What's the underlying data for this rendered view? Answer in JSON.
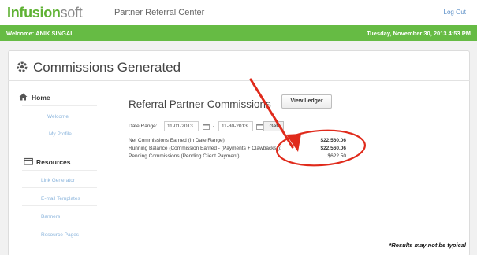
{
  "header": {
    "brand_part1": "Infusion",
    "brand_part2": "soft",
    "app_title": "Partner Referral Center",
    "logout_label": "Log Out"
  },
  "statusbar": {
    "welcome": "Welcome: ANIK SINGAL",
    "datetime": "Tuesday, November 30, 2013 4:53 PM"
  },
  "page": {
    "title": "Commissions Generated"
  },
  "sidebar": {
    "home_heading": "Home",
    "home_links": [
      "Welcome",
      "My Profile"
    ],
    "resources_heading": "Resources",
    "resources_links": [
      "Link Generator",
      "E-mail Templates",
      "Banners",
      "Resource Pages"
    ]
  },
  "main": {
    "title": "Referral Partner Commissions",
    "view_ledger_label": "View Ledger",
    "date_range_label": "Date Range:",
    "date_from": "11-01-2013",
    "date_to": "11-30-2013",
    "get_label": "Get",
    "rows": [
      {
        "label": "Net Commissions Earned (In Date Range):",
        "value": "$22,560.06"
      },
      {
        "label": "Running Balance (Commission Earned - (Payments + Clawbacks)):",
        "value": "$22,560.06"
      },
      {
        "label": "Pending Commissions (Pending Client Payment):",
        "value": "$622.50"
      }
    ]
  },
  "annotation": {
    "arrow_color": "#e02a1b",
    "circle_color": "#e02a1b"
  },
  "footer": {
    "disclaimer": "*Results may not be typical"
  }
}
